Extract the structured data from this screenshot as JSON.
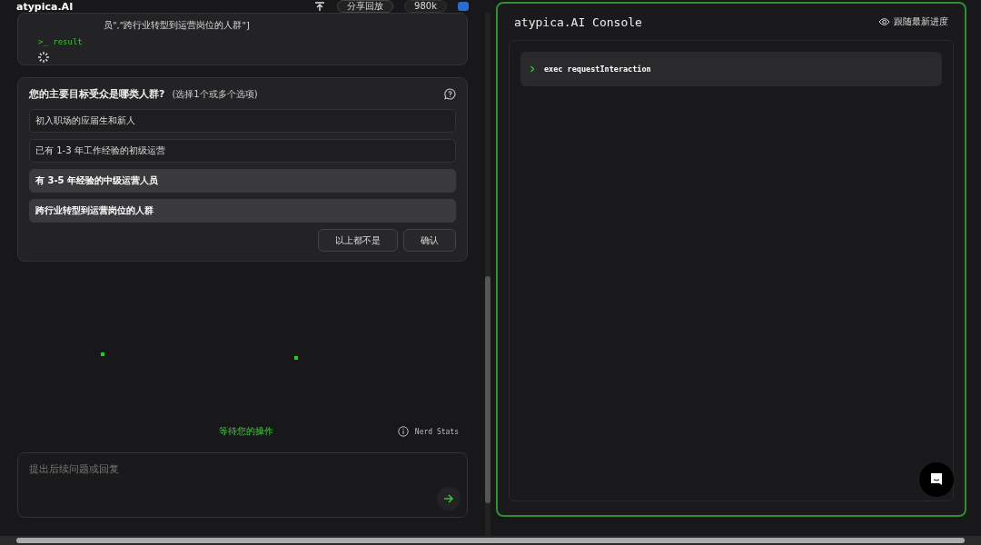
{
  "header": {
    "logo": "atypica.AI",
    "share_label": "分享回放",
    "tokens": "980k"
  },
  "tool_card": {
    "args_tail": "员\",\"跨行业转型到运营岗位的人群\"]",
    "result_label": ">_ result",
    "loading": true
  },
  "question": {
    "title": "您的主要目标受众是哪类人群?",
    "hint": "(选择1个或多个选项)",
    "options": [
      {
        "label": "初入职场的应届生和新人",
        "selected": false
      },
      {
        "label": "已有 1-3 年工作经验的初级运营",
        "selected": false
      },
      {
        "label": "有 3-5 年经验的中级运营人员",
        "selected": true
      },
      {
        "label": "跨行业转型到运营岗位的人群",
        "selected": true
      }
    ],
    "buttons": [
      "以上都不是",
      "确认"
    ]
  },
  "status": "等待您的操作",
  "nerd_stats": "Nerd Stats",
  "composer": {
    "placeholder": "提出后续问题或回复"
  },
  "console": {
    "title": "atypica.AI Console",
    "follow_label": "跟随最新进度",
    "entries": [
      {
        "command": "exec requestInteraction",
        "expanded": false
      }
    ]
  }
}
